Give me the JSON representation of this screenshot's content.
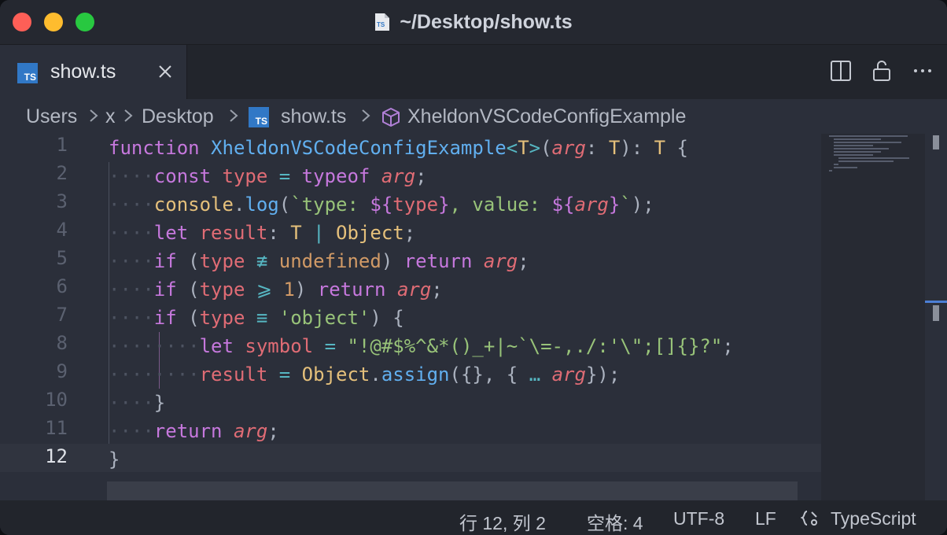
{
  "window": {
    "title": "~/Desktop/show.ts",
    "title_icon": "ts-file-icon"
  },
  "tab": {
    "label": "show.ts",
    "icon": "typescript-icon"
  },
  "tab_actions": [
    "split-editor-icon",
    "unlock-icon",
    "more-icon"
  ],
  "breadcrumb": {
    "items": [
      "Users",
      "x",
      "Desktop",
      "show.ts",
      "XheldonVSCodeConfigExample"
    ]
  },
  "ts_icon_text": "TS",
  "editor": {
    "line_numbers": [
      "1",
      "2",
      "3",
      "4",
      "5",
      "6",
      "7",
      "8",
      "9",
      "10",
      "11",
      "12"
    ],
    "active_line": "12",
    "lines": [
      "function XheldonVSCodeConfigExample<T>(arg: T): T {",
      "    const type = typeof arg;",
      "    console.log(`type: ${type}, value: ${arg}`);",
      "    let result: T | Object;",
      "    if (type ≢ undefined) return arg;",
      "    if (type ⩾ 1) return arg;",
      "    if (type ≡ 'object') {",
      "        let symbol = \"!@#$%^&*()_+|~`\\=-,./:'\\\";[]{}?\";",
      "        result = Object.assign({}, { … arg});",
      "    }",
      "    return arg;",
      "}"
    ]
  },
  "statusbar": {
    "position": "行 12, 列 2",
    "indent": "空格: 4",
    "encoding": "UTF-8",
    "eol": "LF",
    "language": "TypeScript"
  },
  "colors": {
    "keyword": "#c678dd",
    "function": "#61afef",
    "type": "#e5c07b",
    "param": "#e06c75",
    "string": "#98c379",
    "operator": "#56b6c2",
    "ts_blue": "#3178c6"
  }
}
